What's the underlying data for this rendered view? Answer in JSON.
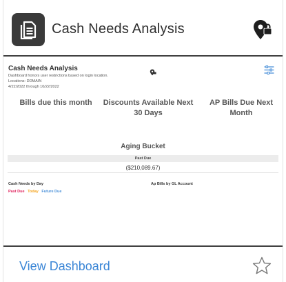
{
  "header": {
    "title": "Cash Needs Analysis",
    "badge_icon": "document-icon",
    "pin_icon": "map-pin-lock-icon"
  },
  "preview": {
    "title": "Cash Needs Analysis",
    "note": "Dashboard honors user restrictions based on login location.",
    "locations": "Locations: DDMAIN",
    "date_range": "4/22/2022 through 10/22/2022",
    "kpis": [
      {
        "label": "Bills due this month"
      },
      {
        "label": "Discounts Available Next 30 Days"
      },
      {
        "label": "AP Bills Due Next Month"
      }
    ],
    "aging": {
      "title": "Aging Bucket",
      "column": "Past Due",
      "value": "($210,089.67)"
    },
    "cash_needs_title": "Cash Needs by Day",
    "ap_gl_title": "Ap Bills by GL Account",
    "legend": [
      {
        "label": "Past Due",
        "color": "#e0245e"
      },
      {
        "label": "Today",
        "color": "#f5a623"
      },
      {
        "label": "Future Due",
        "color": "#4a90d9"
      }
    ]
  },
  "footer": {
    "link_label": "View Dashboard",
    "favorite_icon": "star-outline-icon"
  },
  "colors": {
    "accent": "#3b86d6",
    "badge_bg": "#3a3a3a",
    "divider": "#404040"
  }
}
